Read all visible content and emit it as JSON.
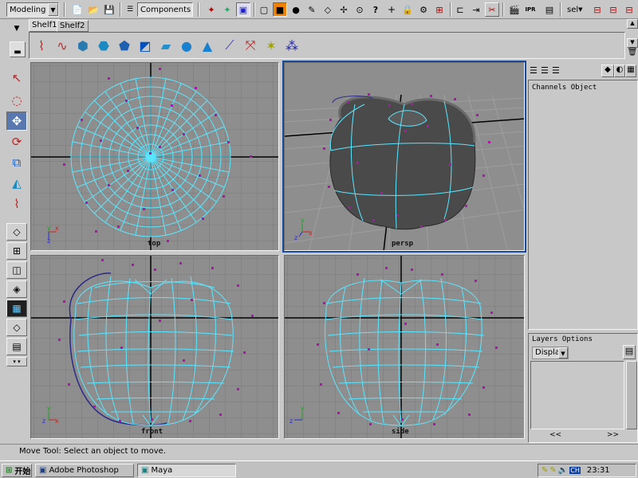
{
  "toolbar": {
    "mode_menu": "Modeling",
    "selection_mask": "Components",
    "sel_label": "sel"
  },
  "shelf": {
    "tabs": [
      {
        "label": "Shelf1"
      },
      {
        "label": "Shelf2"
      }
    ]
  },
  "viewports": {
    "top": "top",
    "persp": "persp",
    "front": "front",
    "side": "side"
  },
  "right_panel": {
    "channels_header": "Channels Object",
    "layers_header": "Layers Options",
    "display_menu": "Display",
    "prev_label": "<<",
    "next_label": ">>"
  },
  "helpline": {
    "text": "Move Tool: Select an object to move."
  },
  "taskbar": {
    "start_label": "开始",
    "tasks": [
      {
        "label": "Adobe Photoshop"
      },
      {
        "label": "Maya"
      }
    ],
    "clock": "23:31",
    "ime_label": "CH"
  },
  "colors": {
    "wireframe": "#5ae6ff",
    "cv_points": "#cc00cc",
    "viewport_bg": "#8e8e8e",
    "active_border": "#1a4a9a"
  }
}
